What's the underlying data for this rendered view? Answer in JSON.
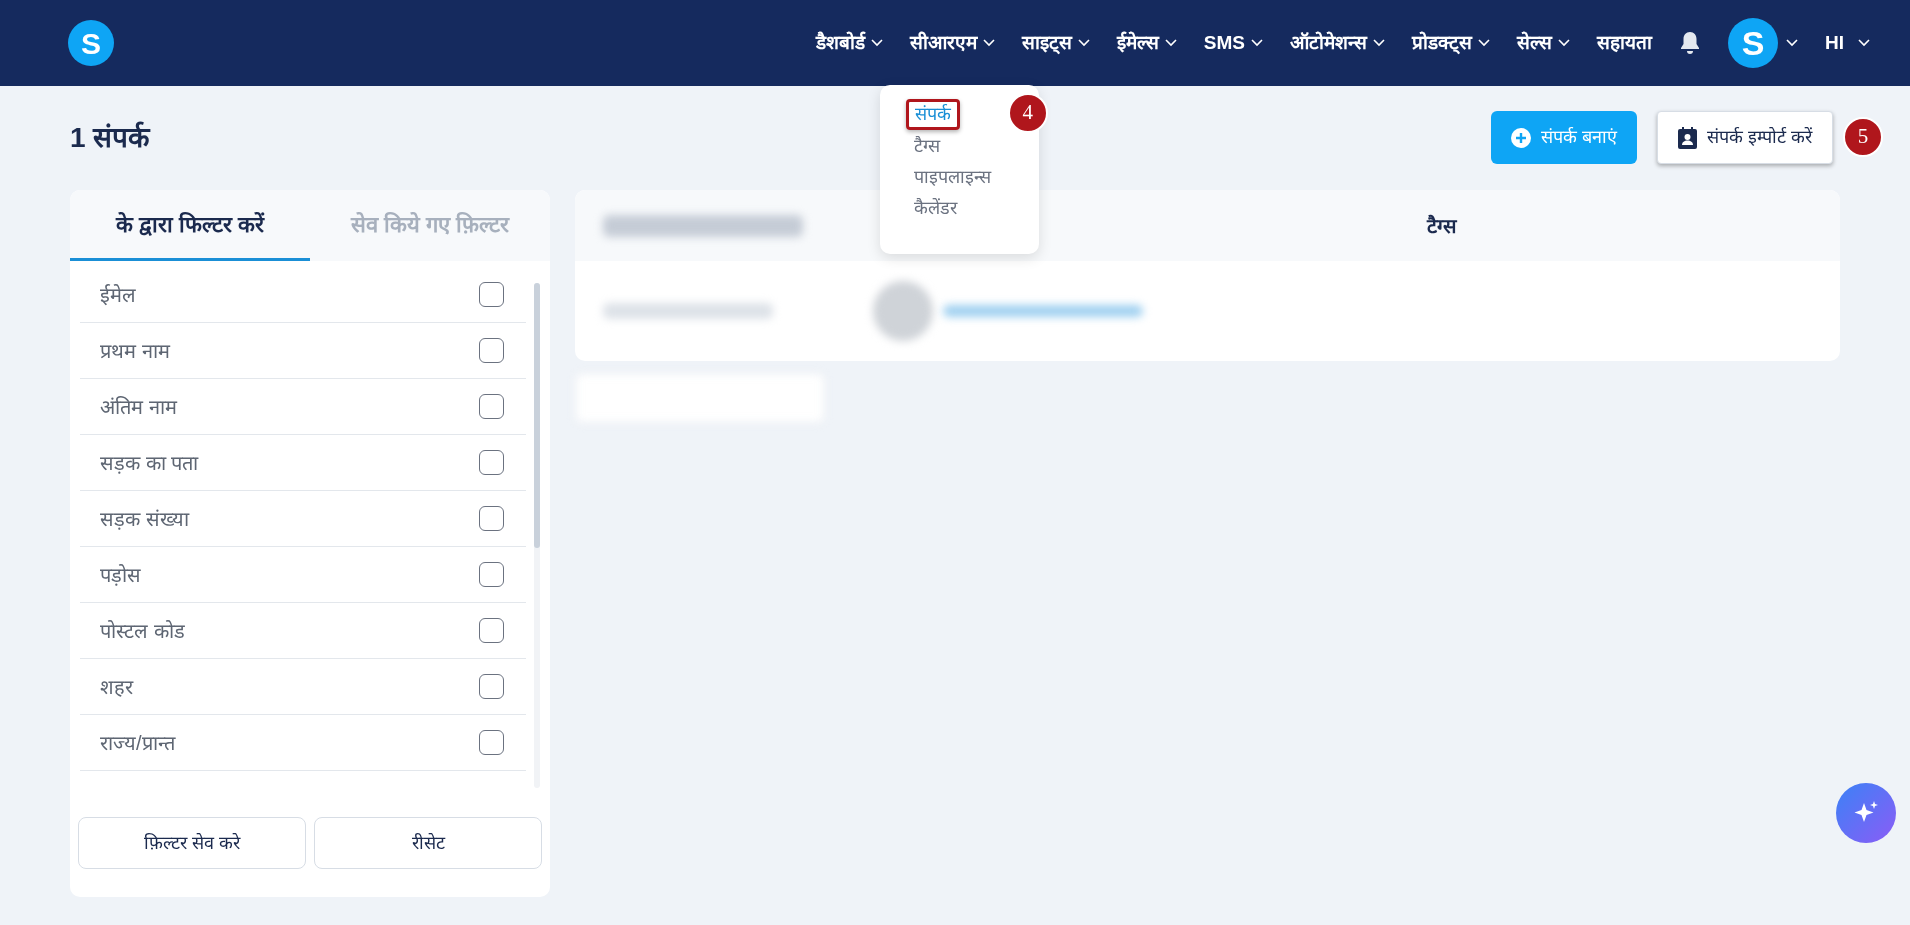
{
  "logo": {
    "letter": "S"
  },
  "nav": {
    "items": [
      {
        "label": "डैशबोर्ड",
        "caret": true
      },
      {
        "label": "सीआरएम",
        "caret": true,
        "expanded": true,
        "children": [
          {
            "label": "संपर्क",
            "selected": true,
            "highlighted": true,
            "callout": "4"
          },
          {
            "label": "टैग्स",
            "selected": false,
            "highlighted": false
          },
          {
            "label": "पाइपलाइन्स",
            "selected": false,
            "highlighted": false
          },
          {
            "label": "कैलेंडर",
            "selected": false,
            "highlighted": false
          }
        ]
      },
      {
        "label": "साइट्स",
        "caret": true
      },
      {
        "label": "ईमेल्स",
        "caret": true
      },
      {
        "label": "SMS",
        "caret": true
      },
      {
        "label": "ऑटोमेशन्स",
        "caret": true
      },
      {
        "label": "प्रोडक्ट्स",
        "caret": true
      },
      {
        "label": "सेल्स",
        "caret": true
      },
      {
        "label": "सहायता",
        "caret": false
      }
    ],
    "avatar": "S",
    "language": "HI"
  },
  "page": {
    "title": "1 संपर्क"
  },
  "actions": [
    {
      "label": "संपर्क बनाएं",
      "kind": "primary",
      "highlighted": false
    },
    {
      "label": "संपर्क इम्पोर्ट करें",
      "kind": "outline",
      "highlighted": true,
      "callout": "5"
    }
  ],
  "filter_tabs": [
    {
      "label": "के द्वारा फिल्टर करें",
      "selected": true
    },
    {
      "label": "सेव किये गए फ़िल्टर",
      "selected": false
    }
  ],
  "filters": [
    {
      "label": "ईमेल",
      "checked": false
    },
    {
      "label": "प्रथम नाम",
      "checked": false
    },
    {
      "label": "अंतिम नाम",
      "checked": false
    },
    {
      "label": "सड़क का पता",
      "checked": false
    },
    {
      "label": "सड़क संख्या",
      "checked": false
    },
    {
      "label": "पड़ोस",
      "checked": false
    },
    {
      "label": "पोस्टल कोड",
      "checked": false
    },
    {
      "label": "शहर",
      "checked": false
    },
    {
      "label": "राज्य/प्रान्त",
      "checked": false
    }
  ],
  "filter_buttons": [
    "फ़िल्टर सेव करे",
    "रीसेट"
  ],
  "table": {
    "columns": [
      "टैग्स"
    ]
  }
}
